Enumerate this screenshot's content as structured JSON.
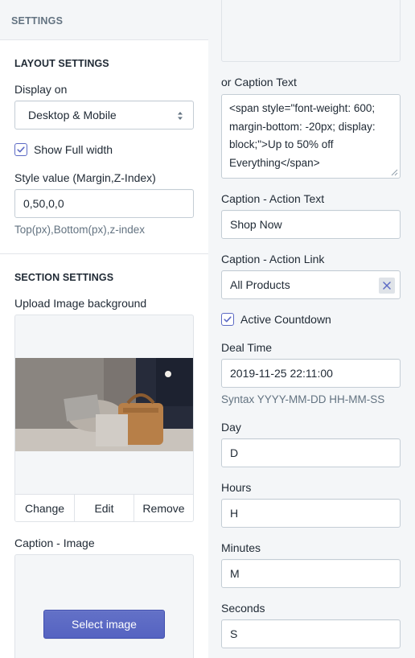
{
  "left": {
    "header": "SETTINGS",
    "layout": {
      "title": "LAYOUT SETTINGS",
      "display_on_label": "Display on",
      "display_on_value": "Desktop & Mobile",
      "show_full_width_label": "Show Full width",
      "show_full_width_checked": true,
      "style_label": "Style value (Margin,Z-Index)",
      "style_value": "0,50,0,0",
      "style_help": "Top(px),Bottom(px),z-index"
    },
    "section": {
      "title": "SECTION SETTINGS",
      "upload_label": "Upload Image background",
      "actions": [
        "Change",
        "Edit",
        "Remove"
      ],
      "caption_image_label": "Caption - Image",
      "select_image_label": "Select image"
    }
  },
  "right": {
    "caption_text_label": "or Caption Text",
    "caption_text_value": "<span style=\"font-weight: 600; margin-bottom: -20px; display: block;\">Up to 50% off Everything</span>",
    "action_text_label": "Caption - Action Text",
    "action_text_value": "Shop Now",
    "action_link_label": "Caption - Action Link",
    "action_link_value": "All Products",
    "active_countdown_label": "Active Countdown",
    "active_countdown_checked": true,
    "deal_time_label": "Deal Time",
    "deal_time_value": "2019-11-25 22:11:00",
    "deal_time_help": "Syntax YYYY-MM-DD HH-MM-SS",
    "day_label": "Day",
    "day_value": "D",
    "hours_label": "Hours",
    "hours_value": "H",
    "minutes_label": "Minutes",
    "minutes_value": "M",
    "seconds_label": "Seconds",
    "seconds_value": "S"
  },
  "colors": {
    "accent": "#5c6ac4",
    "panel_bg": "#f4f6f8",
    "border": "#c4cdd5",
    "help_text": "#637381"
  },
  "icons": {
    "select_arrows": "chevron-up-down-icon",
    "checkbox_mark": "checkmark-icon",
    "clear": "close-icon",
    "resize": "resize-grip-icon"
  }
}
